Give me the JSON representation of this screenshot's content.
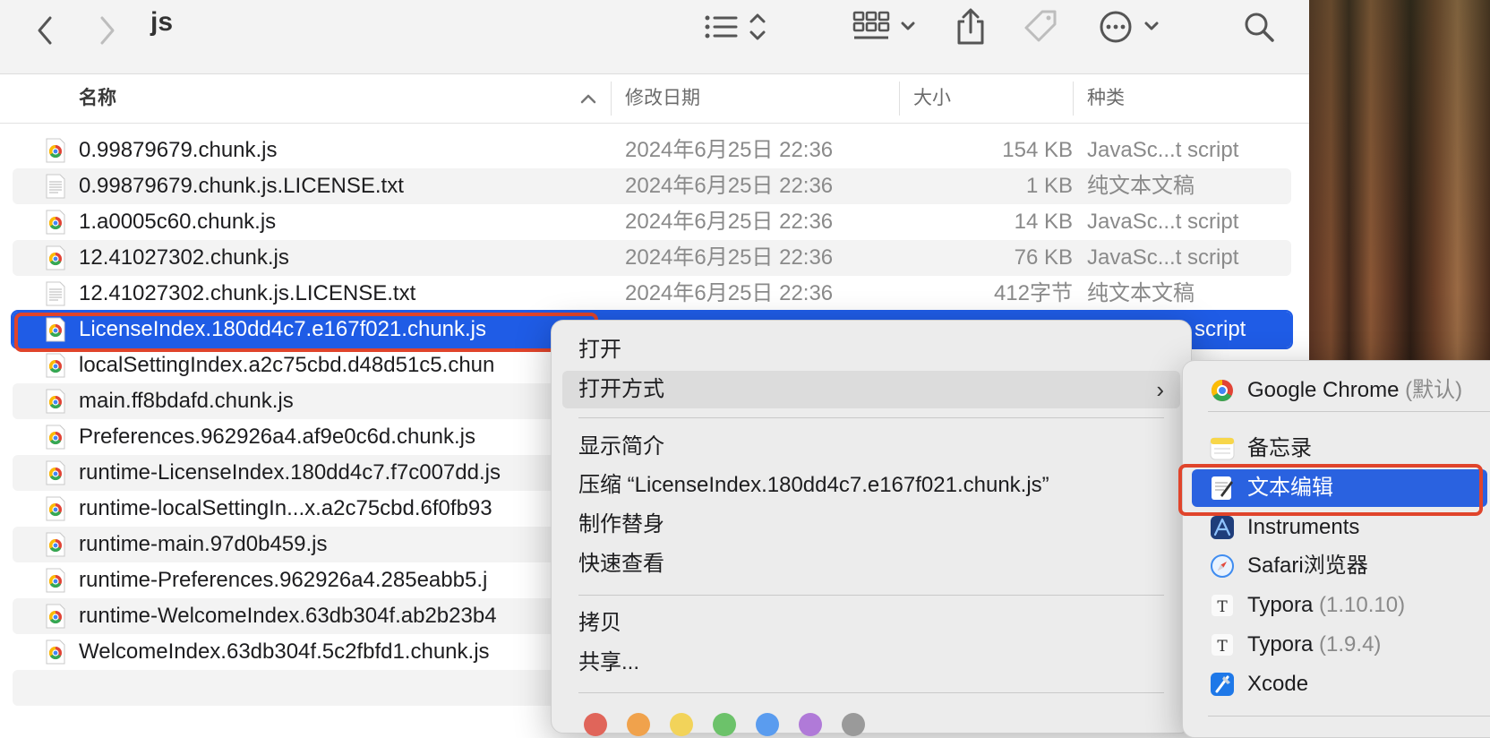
{
  "window": {
    "title": "js"
  },
  "toolbar": {
    "back_icon": "chevron-left-icon",
    "forward_icon": "chevron-right-icon",
    "view_icon": "list-view-icon",
    "group_icon": "grid-group-icon",
    "share_icon": "share-icon",
    "tag_icon": "tag-icon",
    "more_icon": "ellipsis-circle-icon",
    "search_icon": "search-icon"
  },
  "columns": {
    "name": "名称",
    "date": "修改日期",
    "size": "大小",
    "kind": "种类"
  },
  "files": [
    {
      "name": "0.99879679.chunk.js",
      "date": "2024年6月25日 22:36",
      "size": "154 KB",
      "kind": "JavaSc...t script",
      "icon": "chrome"
    },
    {
      "name": "0.99879679.chunk.js.LICENSE.txt",
      "date": "2024年6月25日 22:36",
      "size": "1 KB",
      "kind": "纯文本文稿",
      "icon": "text"
    },
    {
      "name": "1.a0005c60.chunk.js",
      "date": "2024年6月25日 22:36",
      "size": "14 KB",
      "kind": "JavaSc...t script",
      "icon": "chrome"
    },
    {
      "name": "12.41027302.chunk.js",
      "date": "2024年6月25日 22:36",
      "size": "76 KB",
      "kind": "JavaSc...t script",
      "icon": "chrome"
    },
    {
      "name": "12.41027302.chunk.js.LICENSE.txt",
      "date": "2024年6月25日 22:36",
      "size": "412字节",
      "kind": "纯文本文稿",
      "icon": "text"
    },
    {
      "name": "LicenseIndex.180dd4c7.e167f021.chunk.js",
      "date": "",
      "size": "",
      "kind": "script",
      "icon": "chrome",
      "selected": true
    },
    {
      "name": "localSettingIndex.a2c75cbd.d48d51c5.chun",
      "date": "",
      "size": "",
      "kind": "",
      "icon": "chrome"
    },
    {
      "name": "main.ff8bdafd.chunk.js",
      "date": "",
      "size": "",
      "kind": "",
      "icon": "chrome"
    },
    {
      "name": "Preferences.962926a4.af9e0c6d.chunk.js",
      "date": "",
      "size": "",
      "kind": "",
      "icon": "chrome"
    },
    {
      "name": "runtime-LicenseIndex.180dd4c7.f7c007dd.js",
      "date": "",
      "size": "",
      "kind": "",
      "icon": "chrome"
    },
    {
      "name": "runtime-localSettingIn...x.a2c75cbd.6f0fb93",
      "date": "",
      "size": "",
      "kind": "",
      "icon": "chrome"
    },
    {
      "name": "runtime-main.97d0b459.js",
      "date": "",
      "size": "",
      "kind": "",
      "icon": "chrome"
    },
    {
      "name": "runtime-Preferences.962926a4.285eabb5.j",
      "date": "",
      "size": "",
      "kind": "",
      "icon": "chrome"
    },
    {
      "name": "runtime-WelcomeIndex.63db304f.ab2b23b4",
      "date": "",
      "size": "",
      "kind": "",
      "icon": "chrome"
    },
    {
      "name": "WelcomeIndex.63db304f.5c2fbfd1.chunk.js",
      "date": "",
      "size": "",
      "kind": "",
      "icon": "chrome"
    }
  ],
  "context_menu": {
    "open": "打开",
    "open_with": "打开方式",
    "get_info": "显示简介",
    "compress": "压缩 “LicenseIndex.180dd4c7.e167f021.chunk.js”",
    "make_alias": "制作替身",
    "quick_look": "快速查看",
    "copy": "拷贝",
    "share": "共享...",
    "tag_colors": [
      "#e0655a",
      "#f0a24c",
      "#f2d35a",
      "#6cc26a",
      "#5a9cef",
      "#b07ad8",
      "#9a9a9a"
    ]
  },
  "open_with_menu": [
    {
      "name": "Google Chrome",
      "suffix": "(默认)",
      "icon": "chrome-icon"
    },
    {
      "name": "备忘录",
      "suffix": "",
      "icon": "notes-icon"
    },
    {
      "name": "文本编辑",
      "suffix": "",
      "icon": "textedit-icon",
      "active": true
    },
    {
      "name": "Instruments",
      "suffix": "",
      "icon": "instruments-icon"
    },
    {
      "name": "Safari浏览器",
      "suffix": "",
      "icon": "safari-icon"
    },
    {
      "name": "Typora",
      "suffix": "(1.10.10)",
      "icon": "typora-icon"
    },
    {
      "name": "Typora",
      "suffix": "(1.9.4)",
      "icon": "typora-icon"
    },
    {
      "name": "Xcode",
      "suffix": "",
      "icon": "xcode-icon"
    }
  ],
  "colors": {
    "selection": "#1f5ce6",
    "annotation": "#e0442b"
  }
}
